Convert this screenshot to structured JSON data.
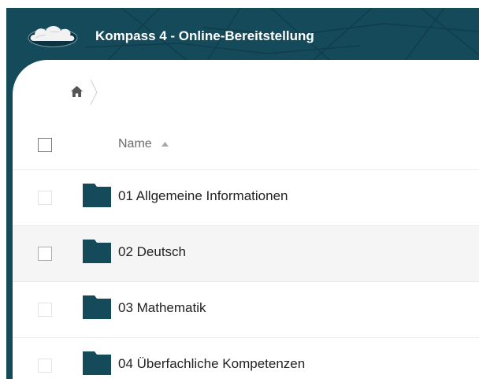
{
  "app": {
    "title": "Kompass 4 - Online-Bereitstellung",
    "logo_icon": "cloud-logo-icon",
    "brand_color": "#154a5a"
  },
  "breadcrumb": {
    "home_icon": "home-icon",
    "separator_icon": "chevron-right-icon"
  },
  "file_list": {
    "columns": [
      {
        "label": "Name",
        "sort": "ascending",
        "sort_icon": "sort-up-icon"
      }
    ],
    "select_all_checked": false,
    "rows": [
      {
        "label": "01 Allgemeine Informationen",
        "icon": "folder-icon",
        "checked": false
      },
      {
        "label": "02 Deutsch",
        "icon": "folder-icon",
        "checked": false,
        "hovered": true
      },
      {
        "label": "03 Mathematik",
        "icon": "folder-icon",
        "checked": false
      },
      {
        "label": "04 Überfachliche Kompetenzen",
        "icon": "folder-icon",
        "checked": false
      }
    ]
  }
}
